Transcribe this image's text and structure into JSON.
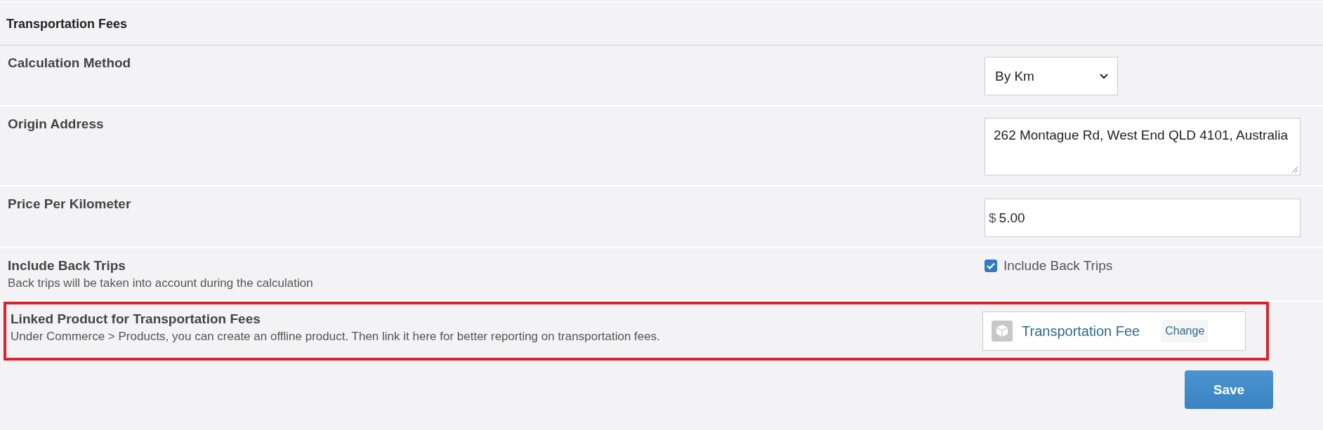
{
  "section": {
    "title": "Transportation Fees"
  },
  "rows": [
    {
      "label": "Calculation Method",
      "kind": "select",
      "value": "By Km",
      "highlighted": false
    },
    {
      "label": "Origin Address",
      "kind": "textarea",
      "value": "262 Montague Rd, West End QLD 4101, Australia",
      "highlighted": false
    },
    {
      "label": "Price Per Kilometer",
      "kind": "currency",
      "prefix": "$",
      "value": "5.00",
      "highlighted": false
    },
    {
      "label": "Include Back Trips",
      "description": "Back trips will be taken into account during the calculation",
      "kind": "checkbox",
      "checkbox_label": "Include Back Trips",
      "checked": true,
      "highlighted": false
    },
    {
      "label": "Linked Product for Transportation Fees",
      "description": "Under Commerce > Products, you can create an offline product. Then link it here for better reporting on transportation fees.",
      "kind": "product",
      "product": "Transportation Fee",
      "action": "Change",
      "highlighted": true
    }
  ],
  "buttons": [
    "Save"
  ]
}
